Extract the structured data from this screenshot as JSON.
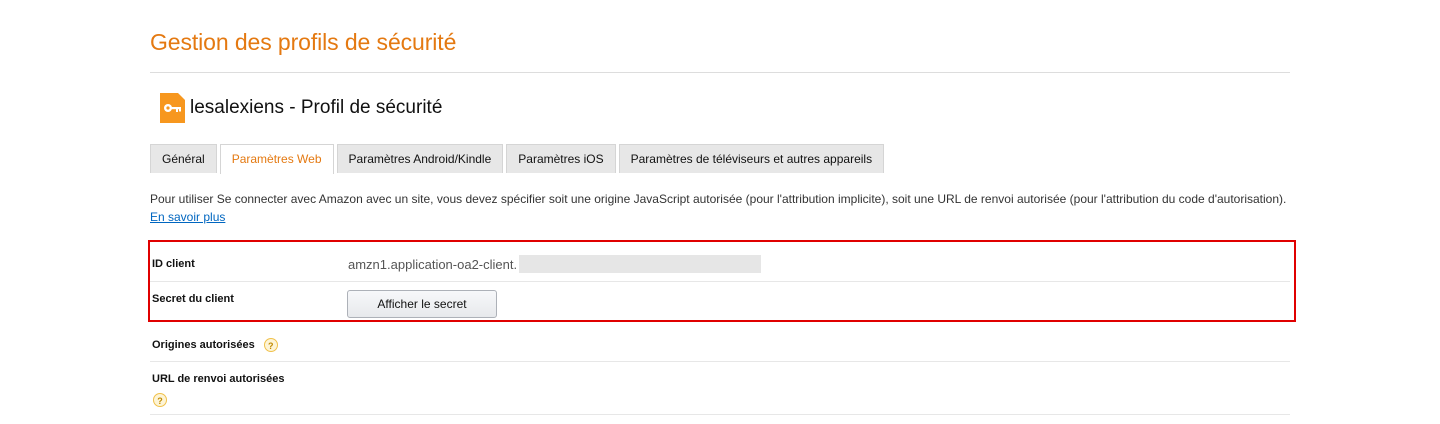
{
  "page": {
    "title": "Gestion des profils de sécurité"
  },
  "profile": {
    "name": "lesalexiens - Profil de sécurité",
    "icon": "key-icon"
  },
  "tabs": [
    {
      "label": "Général",
      "active": false
    },
    {
      "label": "Paramètres Web",
      "active": true
    },
    {
      "label": "Paramètres Android/Kindle",
      "active": false
    },
    {
      "label": "Paramètres iOS",
      "active": false
    },
    {
      "label": "Paramètres de téléviseurs et autres appareils",
      "active": false
    }
  ],
  "description": {
    "text": "Pour utiliser Se connecter avec Amazon avec un site, vous devez spécifier soit une origine JavaScript autorisée (pour l'attribution implicite), soit une URL de renvoi autorisée (pour l'attribution du code d'autorisation).",
    "link": "En savoir plus"
  },
  "fields": {
    "client_id_label": "ID client",
    "client_id_value": "amzn1.application-oa2-client.",
    "client_secret_label": "Secret du client",
    "show_secret_button": "Afficher le secret",
    "origins_label": "Origines autorisées",
    "return_urls_label": "URL de renvoi autorisées",
    "help_glyph": "?"
  },
  "colors": {
    "accent": "#e47911",
    "link": "#0066c0",
    "highlight_border": "#e00000"
  }
}
